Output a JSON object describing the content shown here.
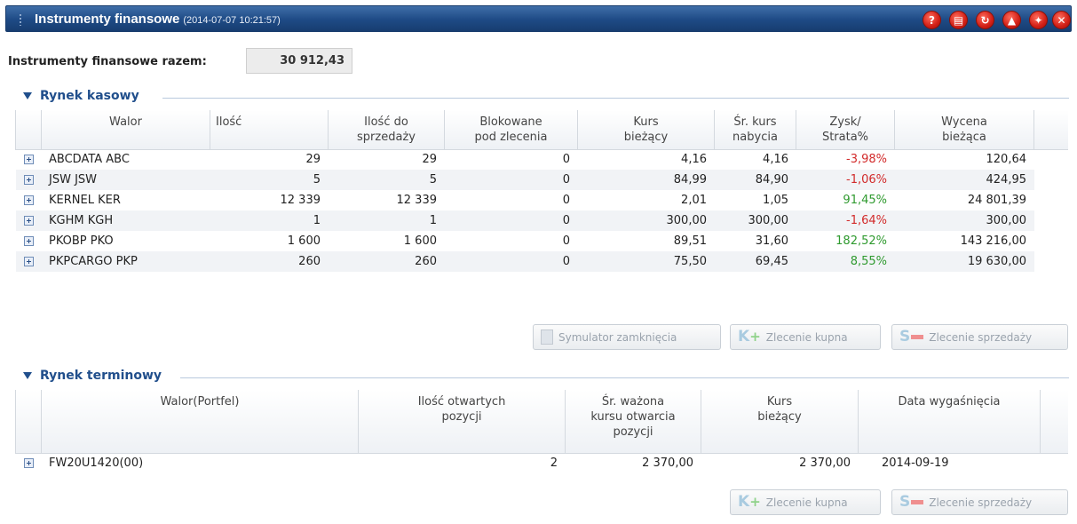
{
  "window": {
    "title": "Instrumenty finansowe",
    "timestamp": "(2014-07-07 10:21:57)",
    "buttons": [
      {
        "name": "help-icon",
        "glyph": "?"
      },
      {
        "name": "print-icon",
        "glyph": "▤"
      },
      {
        "name": "refresh-icon",
        "glyph": "↻"
      },
      {
        "name": "collapse-icon",
        "glyph": "▲"
      },
      {
        "name": "pin-icon",
        "glyph": "✦"
      },
      {
        "name": "close-icon",
        "glyph": "✕"
      }
    ]
  },
  "summary": {
    "label": "Instrumenty finansowe razem:",
    "value": "30 912,43"
  },
  "cash_market": {
    "title": "Rynek kasowy",
    "columns": [
      {
        "line1": "Walor",
        "line2": ""
      },
      {
        "line1": "Ilość",
        "line2": ""
      },
      {
        "line1": "Ilość do",
        "line2": "sprzedaży"
      },
      {
        "line1": "Blokowane",
        "line2": "pod zlecenia"
      },
      {
        "line1": "Kurs",
        "line2": "bieżący"
      },
      {
        "line1": "Śr. kurs",
        "line2": "nabycia"
      },
      {
        "line1": "Zysk/",
        "line2": "Strata%"
      },
      {
        "line1": "Wycena",
        "line2": "bieżąca"
      }
    ],
    "rows": [
      {
        "walor": "ABCDATA ABC",
        "ilosc": "29",
        "ilosc_do_sprzedazy": "29",
        "blokowane": "0",
        "kurs": "4,16",
        "sr_kurs": "4,16",
        "zysk": "-3,98%",
        "zysk_sign": "neg",
        "wycena": "120,64"
      },
      {
        "walor": "JSW JSW",
        "ilosc": "5",
        "ilosc_do_sprzedazy": "5",
        "blokowane": "0",
        "kurs": "84,99",
        "sr_kurs": "84,90",
        "zysk": "-1,06%",
        "zysk_sign": "neg",
        "wycena": "424,95"
      },
      {
        "walor": "KERNEL KER",
        "ilosc": "12 339",
        "ilosc_do_sprzedazy": "12 339",
        "blokowane": "0",
        "kurs": "2,01",
        "sr_kurs": "1,05",
        "zysk": "91,45%",
        "zysk_sign": "pos",
        "wycena": "24 801,39"
      },
      {
        "walor": "KGHM KGH",
        "ilosc": "1",
        "ilosc_do_sprzedazy": "1",
        "blokowane": "0",
        "kurs": "300,00",
        "sr_kurs": "300,00",
        "zysk": "-1,64%",
        "zysk_sign": "neg",
        "wycena": "300,00"
      },
      {
        "walor": "PKOBP PKO",
        "ilosc": "1 600",
        "ilosc_do_sprzedazy": "1 600",
        "blokowane": "0",
        "kurs": "89,51",
        "sr_kurs": "31,60",
        "zysk": "182,52%",
        "zysk_sign": "pos",
        "wycena": "143 216,00"
      },
      {
        "walor": "PKPCARGO PKP",
        "ilosc": "260",
        "ilosc_do_sprzedazy": "260",
        "blokowane": "0",
        "kurs": "75,50",
        "sr_kurs": "69,45",
        "zysk": "8,55%",
        "zysk_sign": "pos",
        "wycena": "19 630,00"
      }
    ],
    "buttons": {
      "simulator": "Symulator zamknięcia",
      "buy": "Zlecenie kupna",
      "sell": "Zlecenie sprzedaży"
    }
  },
  "futures_market": {
    "title": "Rynek terminowy",
    "columns": [
      {
        "lines": [
          "Walor(Portfel)"
        ]
      },
      {
        "lines": [
          "Ilość otwartych",
          "pozycji"
        ]
      },
      {
        "lines": [
          "Śr. ważona",
          "kursu otwarcia",
          "pozycji"
        ]
      },
      {
        "lines": [
          "Kurs",
          "bieżący"
        ]
      },
      {
        "lines": [
          "Data wygaśnięcia"
        ]
      }
    ],
    "rows": [
      {
        "walor": "FW20U1420(00)",
        "ilosc": "2",
        "sr_wazona": "2 370,00",
        "kurs": "2 370,00",
        "data": "2014-09-19"
      }
    ],
    "buttons": {
      "buy": "Zlecenie kupna",
      "sell": "Zlecenie sprzedaży"
    }
  },
  "colors": {
    "titlebar": "#1e4a85",
    "section": "#214f8c",
    "loss": "#d22a2a",
    "gain": "#2f9a2f"
  }
}
